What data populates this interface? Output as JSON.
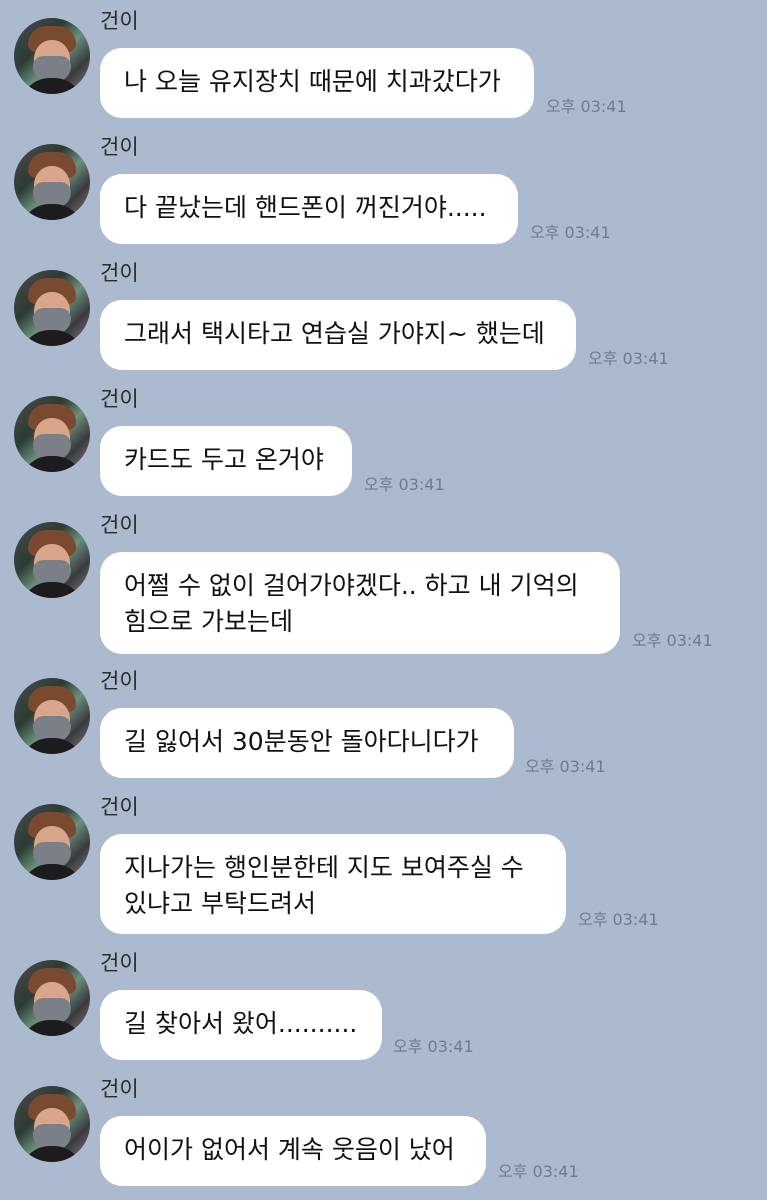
{
  "messages": [
    {
      "sender": "건이",
      "lines": [
        "나 오늘 유지장치 때문에 치과갔다가"
      ],
      "time": "오후 03:41"
    },
    {
      "sender": "건이",
      "lines": [
        "다 끝났는데 핸드폰이 꺼진거야....."
      ],
      "time": "오후 03:41"
    },
    {
      "sender": "건이",
      "lines": [
        "그래서 택시타고 연습실 가야지~ 했는데"
      ],
      "time": "오후 03:41"
    },
    {
      "sender": "건이",
      "lines": [
        "카드도 두고 온거야"
      ],
      "time": "오후 03:41"
    },
    {
      "sender": "건이",
      "lines": [
        "어쩔 수 없이 걸어가야겠다.. 하고 내 기억의",
        "힘으로 가보는데"
      ],
      "time": "오후 03:41"
    },
    {
      "sender": "건이",
      "lines": [
        "길 잃어서 30분동안 돌아다니다가"
      ],
      "time": "오후 03:41"
    },
    {
      "sender": "건이",
      "lines": [
        "지나가는 행인분한테 지도 보여주실 수",
        "있냐고 부탁드려서"
      ],
      "time": "오후 03:41"
    },
    {
      "sender": "건이",
      "lines": [
        "길 찾아서 왔어.........."
      ],
      "time": "오후 03:41"
    },
    {
      "sender": "건이",
      "lines": [
        "어이가 없어서 계속 웃음이 났어"
      ],
      "time": "오후 03:41"
    }
  ]
}
